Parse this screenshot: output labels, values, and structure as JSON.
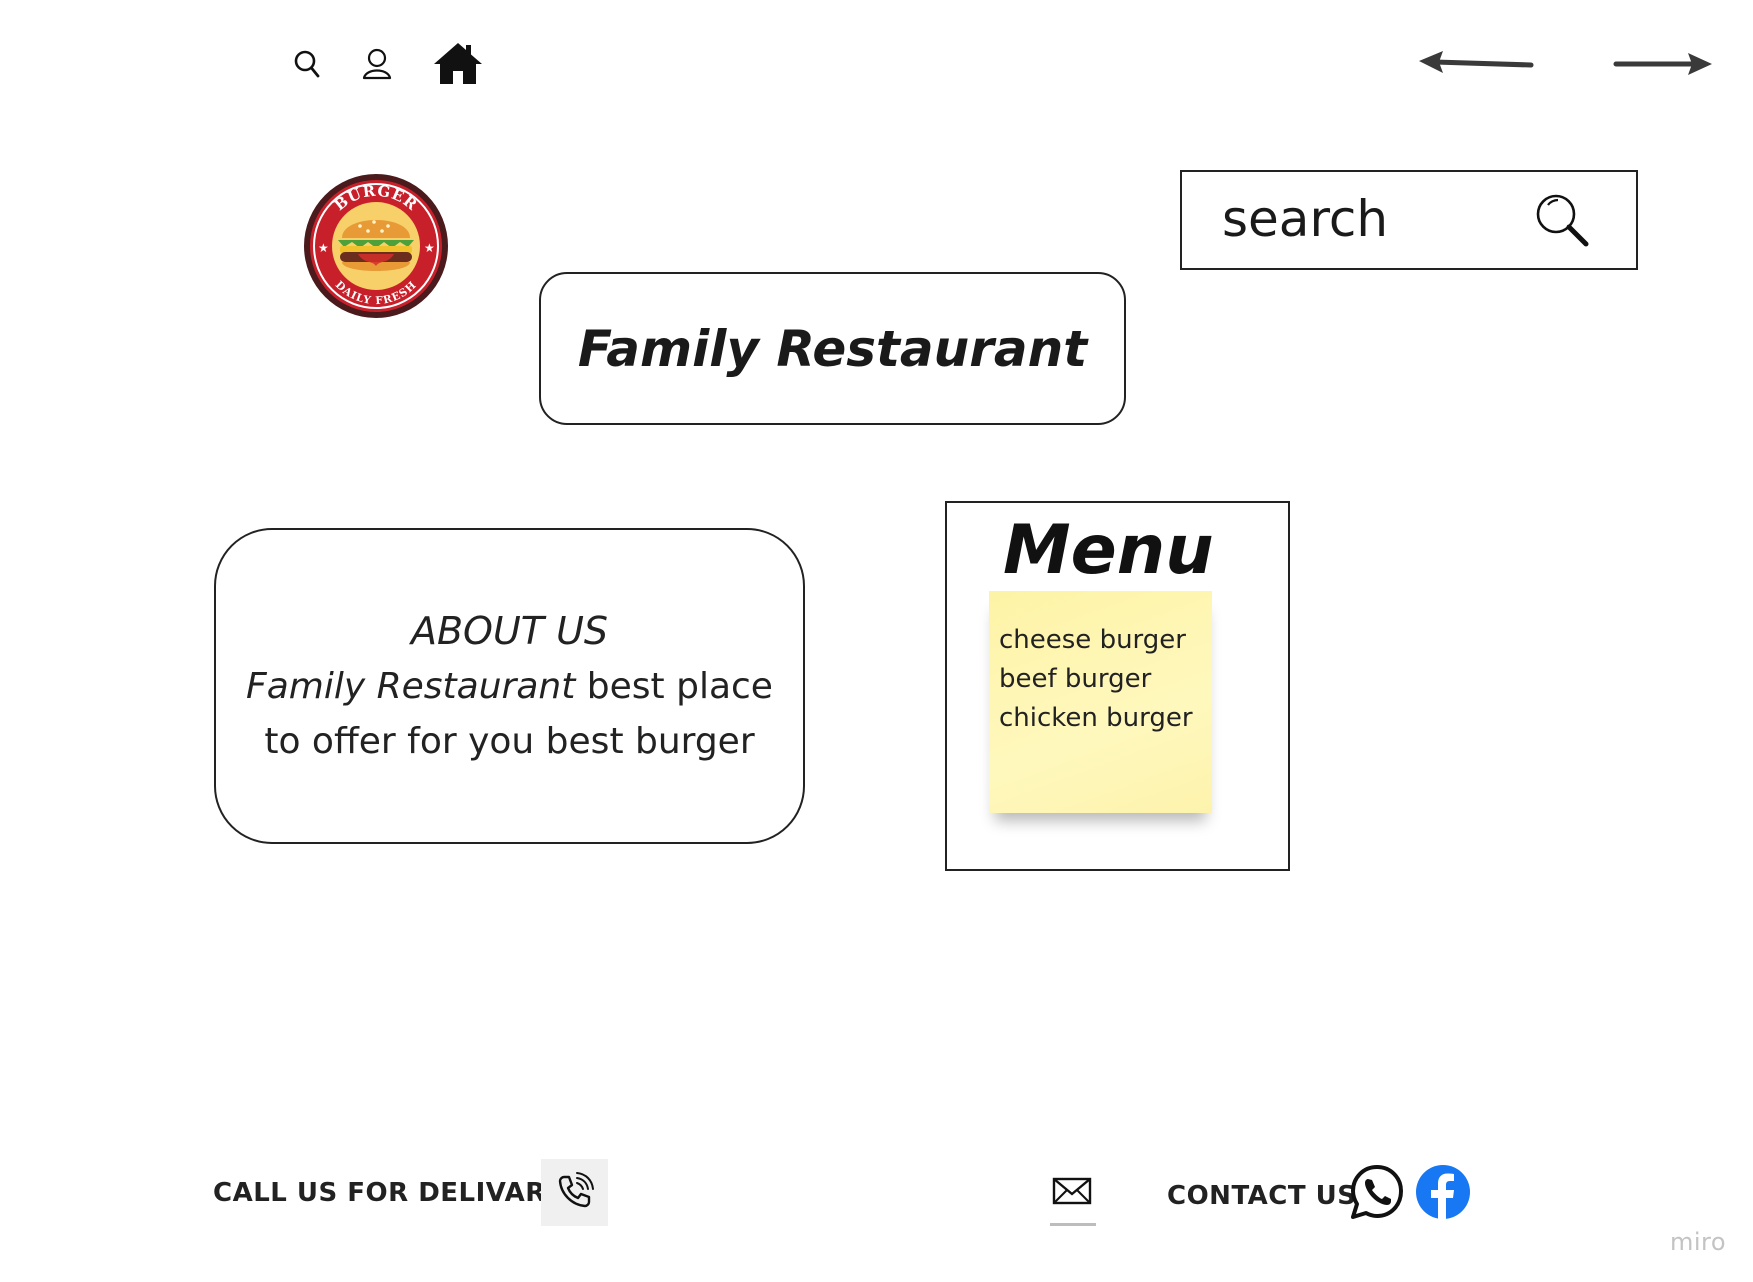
{
  "topbar": {
    "icons": [
      "search-icon",
      "user-icon",
      "home-icon"
    ],
    "nav": [
      "arrow-left-icon",
      "arrow-right-icon"
    ]
  },
  "logo": {
    "top_text": "BURGER",
    "bottom_text": "DAILY FRESH"
  },
  "title": "Family Restaurant",
  "search": {
    "placeholder": "search"
  },
  "about": {
    "heading": "ABOUT US",
    "line1_italic": "Family Restaurant",
    "line1_rest": " best place",
    "line2": "to offer for you best burger"
  },
  "menu": {
    "title": "Menu",
    "items": [
      "cheese burger",
      "beef burger",
      "chicken burger"
    ]
  },
  "footer": {
    "call_label": "CALL US FOR DELIVARY",
    "contact_label": "CONTACT US"
  },
  "watermark": "miro",
  "colors": {
    "sticky_note": "#fff6b3",
    "whatsapp": "#111111",
    "facebook": "#1877f2",
    "logo_red": "#c8202a"
  }
}
